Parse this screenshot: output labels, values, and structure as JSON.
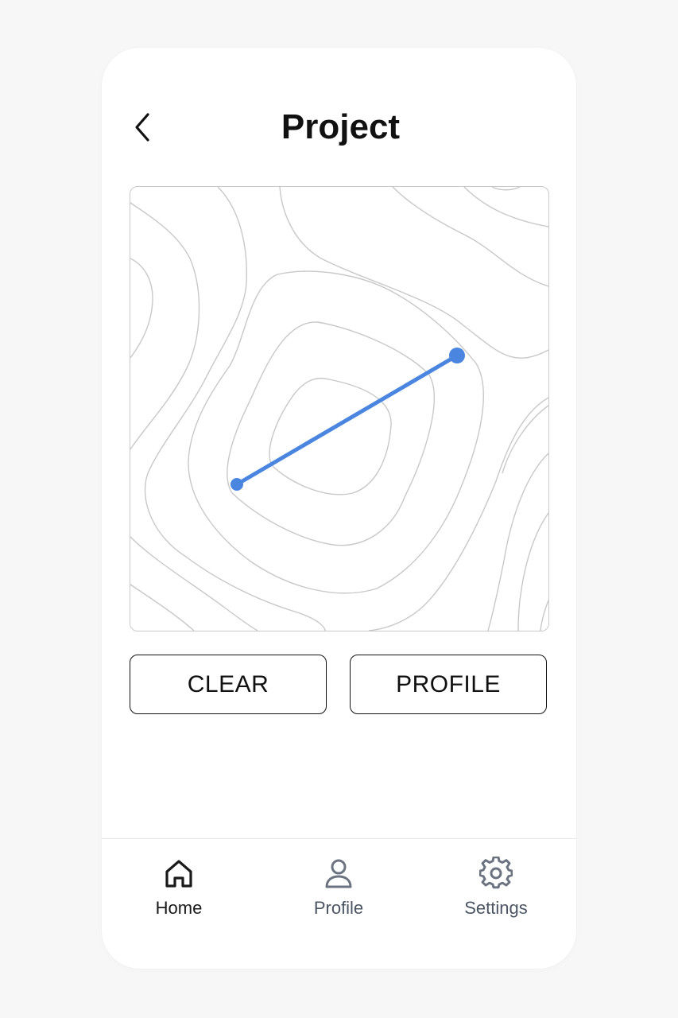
{
  "header": {
    "title": "Project",
    "back_icon": "chevron-left-icon"
  },
  "map": {
    "route_color": "#4a86e0",
    "contour_color": "#c8c8c8",
    "route_points": 2
  },
  "actions": {
    "clear_label": "CLEAR",
    "profile_label": "PROFILE"
  },
  "tabbar": {
    "active_color": "#1a1a1a",
    "inactive_color": "#6b7280",
    "tabs": [
      {
        "label": "Home",
        "icon": "home-icon",
        "active": true
      },
      {
        "label": "Profile",
        "icon": "user-icon",
        "active": false
      },
      {
        "label": "Settings",
        "icon": "gear-icon",
        "active": false
      }
    ]
  }
}
